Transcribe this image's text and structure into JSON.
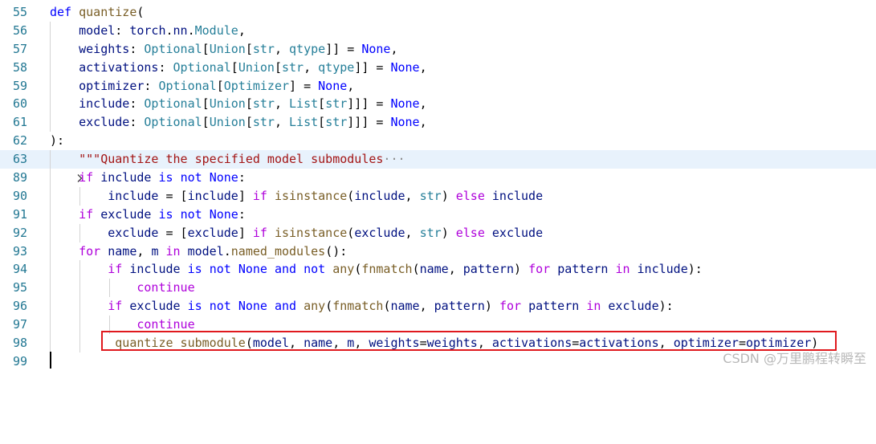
{
  "editor": {
    "language": "python",
    "lines": [
      {
        "number": "55",
        "text": "def quantize("
      },
      {
        "number": "56",
        "text": "    model: torch.nn.Module,"
      },
      {
        "number": "57",
        "text": "    weights: Optional[Union[str, qtype]] = None,"
      },
      {
        "number": "58",
        "text": "    activations: Optional[Union[str, qtype]] = None,"
      },
      {
        "number": "59",
        "text": "    optimizer: Optional[Optimizer] = None,"
      },
      {
        "number": "60",
        "text": "    include: Optional[Union[str, List[str]]] = None,"
      },
      {
        "number": "61",
        "text": "    exclude: Optional[Union[str, List[str]]] = None,"
      },
      {
        "number": "62",
        "text": "):"
      },
      {
        "number": "63",
        "text": "    \"\"\"Quantize the specified model submodules···",
        "folded": true,
        "highlighted": true
      },
      {
        "number": "89",
        "text": "    if include is not None:"
      },
      {
        "number": "90",
        "text": "        include = [include] if isinstance(include, str) else include"
      },
      {
        "number": "91",
        "text": "    if exclude is not None:"
      },
      {
        "number": "92",
        "text": "        exclude = [exclude] if isinstance(exclude, str) else exclude"
      },
      {
        "number": "93",
        "text": "    for name, m in model.named_modules():"
      },
      {
        "number": "94",
        "text": "        if include is not None and not any(fnmatch(name, pattern) for pattern in include):"
      },
      {
        "number": "95",
        "text": "            continue"
      },
      {
        "number": "96",
        "text": "        if exclude is not None and any(fnmatch(name, pattern) for pattern in exclude):"
      },
      {
        "number": "97",
        "text": "            continue"
      },
      {
        "number": "98",
        "text": "        _quantize_submodule(model, name, m, weights=weights, activations=activations, optimizer=optimizer)",
        "boxed": true
      },
      {
        "number": "99",
        "text": "",
        "cursor": true
      }
    ],
    "fold_icon": "chevron-right-icon",
    "highlight_color": "#e8f2fc",
    "annotation_box_color": "#e0191e"
  },
  "watermark": {
    "text": "CSDN @万里鹏程转瞬至"
  }
}
